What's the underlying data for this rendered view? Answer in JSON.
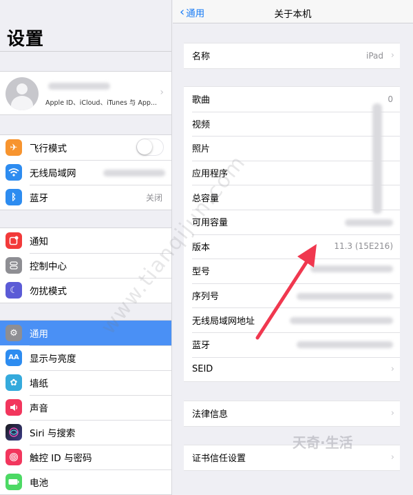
{
  "left": {
    "title": "设置",
    "profile": {
      "subtitle": "Apple ID、iCloud、iTunes 与 App..."
    },
    "connectivity": [
      {
        "label": "飞行模式",
        "icon": "airplane-icon",
        "color": "#f7942f"
      },
      {
        "label": "无线局域网",
        "icon": "wifi-icon",
        "color": "#2d8cf0"
      },
      {
        "label": "蓝牙",
        "icon": "bluetooth-icon",
        "color": "#2d8cf0",
        "value": "关闭"
      }
    ],
    "system": [
      {
        "label": "通知",
        "icon": "notifications-icon",
        "color": "#f23a3a"
      },
      {
        "label": "控制中心",
        "icon": "control-center-icon",
        "color": "#8e8e93"
      },
      {
        "label": "勿扰模式",
        "icon": "moon-icon",
        "color": "#5b5bd6"
      }
    ],
    "general": [
      {
        "label": "通用",
        "icon": "gear-icon",
        "color": "#8e8e93"
      },
      {
        "label": "显示与亮度",
        "icon": "display-icon",
        "color": "#2d8cf0",
        "glyph": "AA"
      },
      {
        "label": "墙纸",
        "icon": "wallpaper-icon",
        "color": "#35aadc"
      },
      {
        "label": "声音",
        "icon": "sound-icon",
        "color": "#f2365d"
      },
      {
        "label": "Siri 与搜索",
        "icon": "siri-icon",
        "color": "#3a3a3c"
      },
      {
        "label": "触控 ID 与密码",
        "icon": "fingerprint-icon",
        "color": "#f2365d"
      },
      {
        "label": "电池",
        "icon": "battery-icon",
        "color": "#4cd964"
      }
    ]
  },
  "right": {
    "back_label": "通用",
    "title": "关于本机",
    "name_row": {
      "label": "名称",
      "value": "iPad"
    },
    "info_rows": [
      {
        "label": "歌曲",
        "value": "0"
      },
      {
        "label": "视频",
        "value": ""
      },
      {
        "label": "照片",
        "value": ""
      },
      {
        "label": "应用程序",
        "value": ""
      },
      {
        "label": "总容量",
        "value": ""
      },
      {
        "label": "可用容量",
        "value": ""
      },
      {
        "label": "版本",
        "value": "11.3 (15E216)"
      },
      {
        "label": "型号",
        "value": ""
      },
      {
        "label": "序列号",
        "value": ""
      },
      {
        "label": "无线局域网地址",
        "value": ""
      },
      {
        "label": "蓝牙",
        "value": ""
      },
      {
        "label": "SEID",
        "value": ""
      }
    ],
    "legal_label": "法律信息",
    "cert_label": "证书信任设置"
  },
  "watermark": "www.tianqijun.com",
  "logo_text": "天奇·生活",
  "colors": {
    "accent": "#1a7cf5",
    "selected_bg": "#4a90f5",
    "arrow": "#f0384f"
  }
}
